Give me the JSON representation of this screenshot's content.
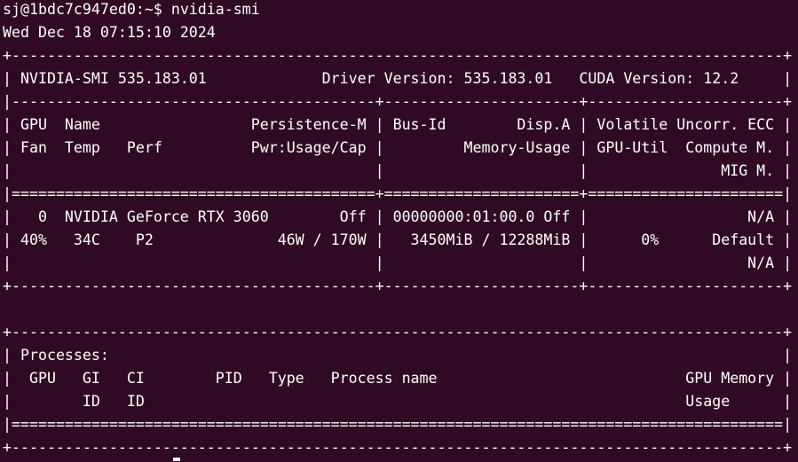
{
  "window": {
    "prompt": "sj@1bdc7c947ed0:~$ ",
    "command": "nvidia-smi"
  },
  "output": {
    "timestamp": "Wed Dec 18 07:15:10 2024",
    "lines": [
      "+---------------------------------------------------------------------------------------+",
      "| NVIDIA-SMI 535.183.01             Driver Version: 535.183.01   CUDA Version: 12.2     |",
      "|-----------------------------------------+----------------------+----------------------+",
      "| GPU  Name                 Persistence-M | Bus-Id        Disp.A | Volatile Uncorr. ECC |",
      "| Fan  Temp   Perf          Pwr:Usage/Cap |         Memory-Usage | GPU-Util  Compute M. |",
      "|                                         |                      |               MIG M. |",
      "|=========================================+======================+======================|",
      "|   0  NVIDIA GeForce RTX 3060        Off | 00000000:01:00.0 Off |                  N/A |",
      "| 40%   34C    P2              46W / 170W |   3450MiB / 12288MiB |      0%      Default |",
      "|                                         |                      |                  N/A |",
      "+-----------------------------------------+----------------------+----------------------+",
      "",
      "+---------------------------------------------------------------------------------------+",
      "| Processes:                                                                            |",
      "|  GPU   GI   CI        PID   Type   Process name                            GPU Memory |",
      "|        ID   ID                                                             Usage      |",
      "|=======================================================================================|",
      "+---------------------------------------------------------------------------------------+"
    ]
  }
}
